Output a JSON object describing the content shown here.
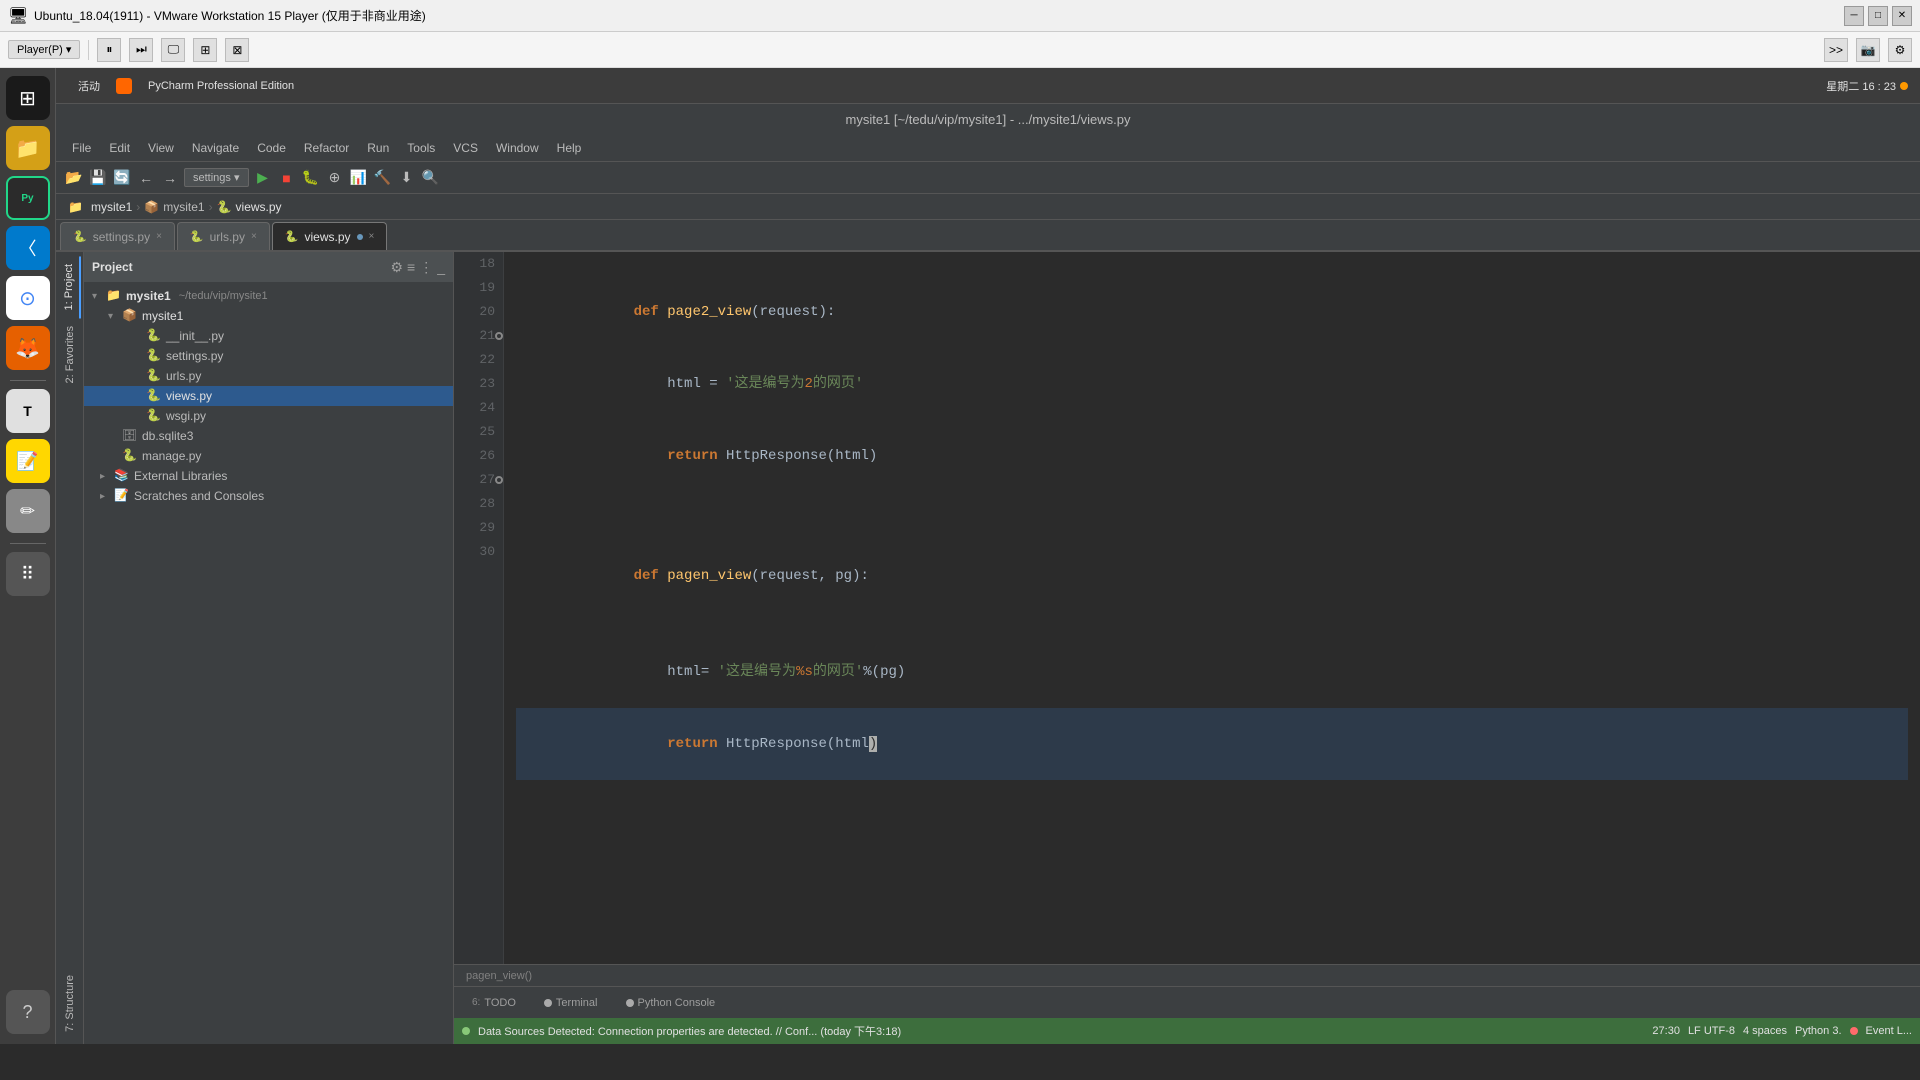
{
  "titlebar": {
    "title": "Ubuntu_18.04(1911) - VMware Workstation 15 Player (仅用于非商业用途)",
    "icon": "🖥",
    "minimize": "─",
    "maximize": "□",
    "close": "✕"
  },
  "vmware": {
    "player_btn": "Player(P) ▾",
    "controls": [
      "⏸",
      "⏩",
      "🖵",
      "⊞",
      "⊠"
    ]
  },
  "ubuntu": {
    "activities": "活动",
    "app_name": "PyCharm Professional Edition",
    "clock": "星期二 16 : 23",
    "dot": "●"
  },
  "pycharm": {
    "title": "mysite1 [~/tedu/vip/mysite1] - .../mysite1/views.py"
  },
  "menu": {
    "items": [
      "File",
      "Edit",
      "View",
      "Navigate",
      "Code",
      "Refactor",
      "Run",
      "Tools",
      "VCS",
      "Window",
      "Help"
    ]
  },
  "breadcrumb": {
    "items": [
      "mysite1",
      "mysite1",
      "views.py"
    ]
  },
  "tabs": {
    "items": [
      {
        "label": "settings.py",
        "modified": false,
        "active": false
      },
      {
        "label": "urls.py",
        "modified": false,
        "active": false
      },
      {
        "label": "views.py",
        "modified": true,
        "active": true
      }
    ]
  },
  "project": {
    "title": "Project",
    "root": {
      "label": "mysite1",
      "path": "~/tedu/vip/mysite1",
      "children": [
        {
          "label": "mysite1",
          "expanded": true,
          "children": [
            {
              "label": "__init__.py",
              "type": "py"
            },
            {
              "label": "settings.py",
              "type": "py"
            },
            {
              "label": "urls.py",
              "type": "py"
            },
            {
              "label": "views.py",
              "type": "py",
              "selected": true
            },
            {
              "label": "wsgi.py",
              "type": "py"
            }
          ]
        },
        {
          "label": "db.sqlite3",
          "type": "db"
        },
        {
          "label": "manage.py",
          "type": "py"
        },
        {
          "label": "External Libraries",
          "type": "folder",
          "collapsed": true
        },
        {
          "label": "Scratches and Consoles",
          "type": "folder",
          "collapsed": true
        }
      ]
    }
  },
  "code": {
    "lines": [
      {
        "num": 18,
        "content": "",
        "type": "empty"
      },
      {
        "num": 19,
        "content": "def page2_view(request):",
        "type": "def"
      },
      {
        "num": 20,
        "content": "    html = '这是编号为2的网页'",
        "type": "assign"
      },
      {
        "num": 21,
        "content": "    return HttpResponse(html)",
        "type": "return"
      },
      {
        "num": 22,
        "content": "",
        "type": "empty"
      },
      {
        "num": 23,
        "content": "",
        "type": "empty"
      },
      {
        "num": 24,
        "content": "def pagen_view(request, pg):",
        "type": "def"
      },
      {
        "num": 25,
        "content": "",
        "type": "empty"
      },
      {
        "num": 26,
        "content": "    html= '这是编号为%s的网页'%(pg)",
        "type": "assign"
      },
      {
        "num": 27,
        "content": "    return HttpResponse(html)",
        "type": "return_current"
      },
      {
        "num": 28,
        "content": "",
        "type": "empty"
      },
      {
        "num": 29,
        "content": "",
        "type": "empty"
      },
      {
        "num": 30,
        "content": "",
        "type": "empty"
      }
    ],
    "function_hint": "pagen_view()"
  },
  "side_panel": {
    "tabs": [
      {
        "label": "1: Project",
        "active": true
      },
      {
        "label": "2: Favorites",
        "active": false
      },
      {
        "label": "7: Structure",
        "active": false
      }
    ]
  },
  "bottom": {
    "tabs": [
      {
        "label": "TODO",
        "num": "6",
        "active": false
      },
      {
        "label": "Terminal",
        "active": false
      },
      {
        "label": "Python Console",
        "active": false
      }
    ],
    "status_msg": "Data Sources Detected: Connection properties are detected. // Conf... (today 下午3:18)",
    "cursor_pos": "27:30",
    "encoding": "LF  UTF-8",
    "indent": "4 spaces",
    "lang": "Python 3.",
    "event_log": "Event L..."
  }
}
